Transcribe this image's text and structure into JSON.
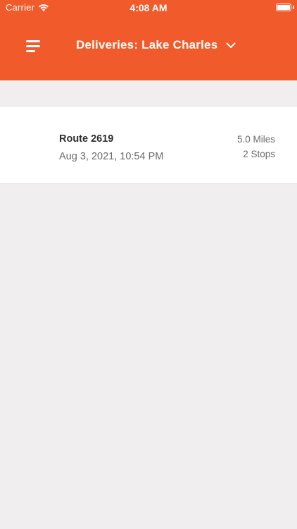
{
  "status_bar": {
    "carrier": "Carrier",
    "time": "4:08 AM"
  },
  "header": {
    "title": "Deliveries: Lake Charles",
    "menu_icon": "menu-icon",
    "dropdown_icon": "chevron-down-icon"
  },
  "routes": [
    {
      "name": "Route 2619",
      "date": "Aug 3, 2021, 10:54 PM",
      "miles": "5.0 Miles",
      "stops": "2 Stops"
    }
  ],
  "colors": {
    "brand": "#f15a2a",
    "background": "#f0eeef",
    "card": "#ffffff"
  }
}
